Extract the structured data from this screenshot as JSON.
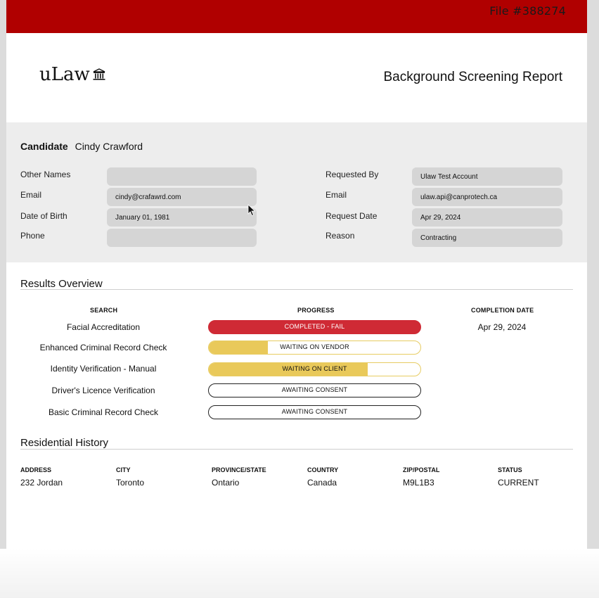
{
  "file_number": "File #388274",
  "brand": {
    "logo_text": "uLaw",
    "logo_icon": "courthouse-icon"
  },
  "report_title": "Background Screening Report",
  "candidate": {
    "label": "Candidate",
    "name": "Cindy Crawford",
    "left_fields": [
      {
        "label": "Other Names",
        "value": ""
      },
      {
        "label": "Email",
        "value": "cindy@crafawrd.com"
      },
      {
        "label": "Date of Birth",
        "value": "January 01, 1981"
      },
      {
        "label": "Phone",
        "value": ""
      }
    ],
    "right_fields": [
      {
        "label": "Requested By",
        "value": "Ulaw Test Account"
      },
      {
        "label": "Email",
        "value": "ulaw.api@canprotech.ca"
      },
      {
        "label": "Request Date",
        "value": "Apr 29, 2024"
      },
      {
        "label": "Reason",
        "value": "Contracting"
      }
    ]
  },
  "results": {
    "title": "Results Overview",
    "headers": {
      "search": "SEARCH",
      "progress": "PROGRESS",
      "completion": "COMPLETION DATE"
    },
    "rows": [
      {
        "search": "Facial Accreditation",
        "status": "COMPLETED - FAIL",
        "progress": 1.0,
        "style": "fail",
        "completion_date": "Apr 29, 2024"
      },
      {
        "search": "Enhanced Criminal Record Check",
        "status": "WAITING ON VENDOR",
        "progress": 0.28,
        "style": "yellow",
        "completion_date": ""
      },
      {
        "search": "Identity Verification - Manual",
        "status": "WAITING ON CLIENT",
        "progress": 0.75,
        "style": "yellow",
        "completion_date": ""
      },
      {
        "search": "Driver's Licence Verification",
        "status": "AWAITING CONSENT",
        "progress": 0,
        "style": "empty",
        "completion_date": ""
      },
      {
        "search": "Basic Criminal Record Check",
        "status": "AWAITING CONSENT",
        "progress": 0,
        "style": "empty",
        "completion_date": ""
      }
    ]
  },
  "residential": {
    "title": "Residential History",
    "headers": [
      "ADDRESS",
      "CITY",
      "PROVINCE/STATE",
      "COUNTRY",
      "ZIP/POSTAL",
      "STATUS"
    ],
    "values": [
      "232 Jordan",
      "Toronto",
      "Ontario",
      "Canada",
      "M9L1B3",
      "CURRENT"
    ]
  },
  "colors": {
    "top_bar": "#b00000",
    "fail": "#cf2a35",
    "pending": "#e9c95a"
  }
}
